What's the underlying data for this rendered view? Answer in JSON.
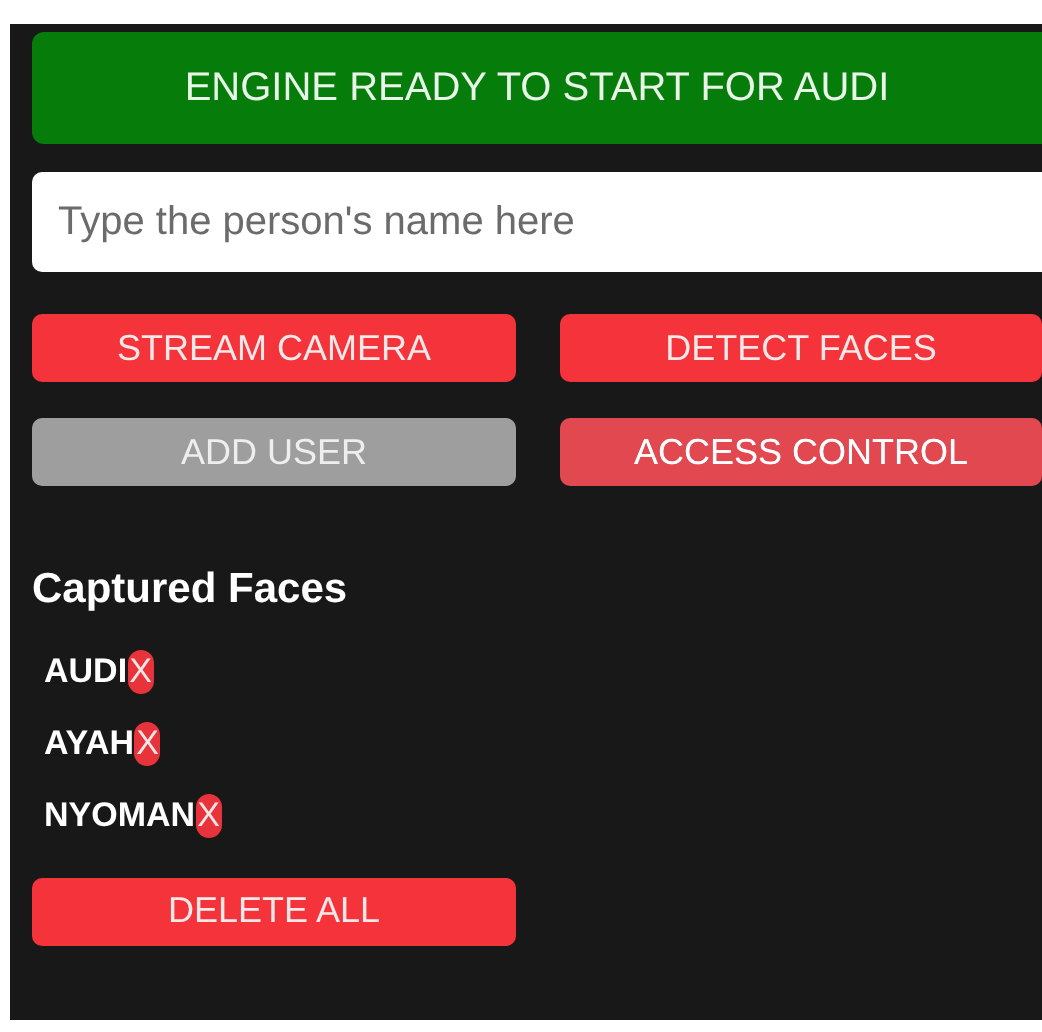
{
  "status_banner": "ENGINE READY TO START FOR AUDI",
  "name_field": {
    "placeholder": "Type the person's name here"
  },
  "buttons": [
    {
      "label": "STREAM CAMERA",
      "disabled": false,
      "pressed": false
    },
    {
      "label": "DETECT FACES",
      "disabled": false,
      "pressed": false
    },
    {
      "label": "ADD USER",
      "disabled": true,
      "pressed": false
    },
    {
      "label": "ACCESS CONTROL",
      "disabled": false,
      "pressed": true
    }
  ],
  "captured_faces": {
    "title": "Captured Faces",
    "items": [
      {
        "name": "AUDI",
        "remove": "X"
      },
      {
        "name": "AYAH",
        "remove": "X"
      },
      {
        "name": "NYOMAN",
        "remove": "X"
      }
    ],
    "delete_all": "DELETE ALL"
  }
}
